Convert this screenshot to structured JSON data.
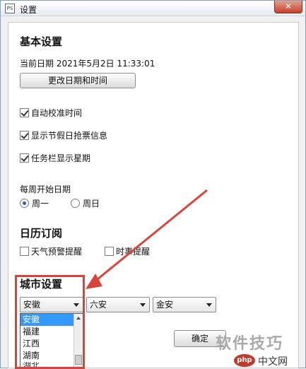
{
  "window": {
    "title": "设置",
    "app_icon_label": "PS"
  },
  "basic": {
    "section_title": "基本设置",
    "current_date": "当前日期 2021年5月2日 11:33:01",
    "change_button": "更改日期和时间",
    "options": [
      {
        "label": "自动校准时间",
        "checked": true
      },
      {
        "label": "显示节假日抢票信息",
        "checked": true
      },
      {
        "label": "任务栏显示星期",
        "checked": true
      }
    ]
  },
  "week": {
    "label": "每周开始日期",
    "options": [
      {
        "label": "周一",
        "selected": true
      },
      {
        "label": "周日",
        "selected": false
      }
    ]
  },
  "calendar": {
    "section_title": "日历订阅",
    "options": [
      {
        "label": "天气预警提醒",
        "checked": false
      },
      {
        "label": "时事提醒",
        "checked": false
      }
    ]
  },
  "city": {
    "section_title": "城市设置",
    "province": "安徽",
    "city": "六安",
    "county": "金安",
    "dropdown_items": [
      "安徽",
      "福建",
      "江西",
      "湖南"
    ],
    "partial_item": "湖北"
  },
  "footer": {
    "ok_button": "确定"
  },
  "watermark": {
    "text": "软件技巧",
    "logo": "php",
    "site": "中文网"
  },
  "colors": {
    "highlight": "#d9443a",
    "selection": "#3399ff"
  }
}
